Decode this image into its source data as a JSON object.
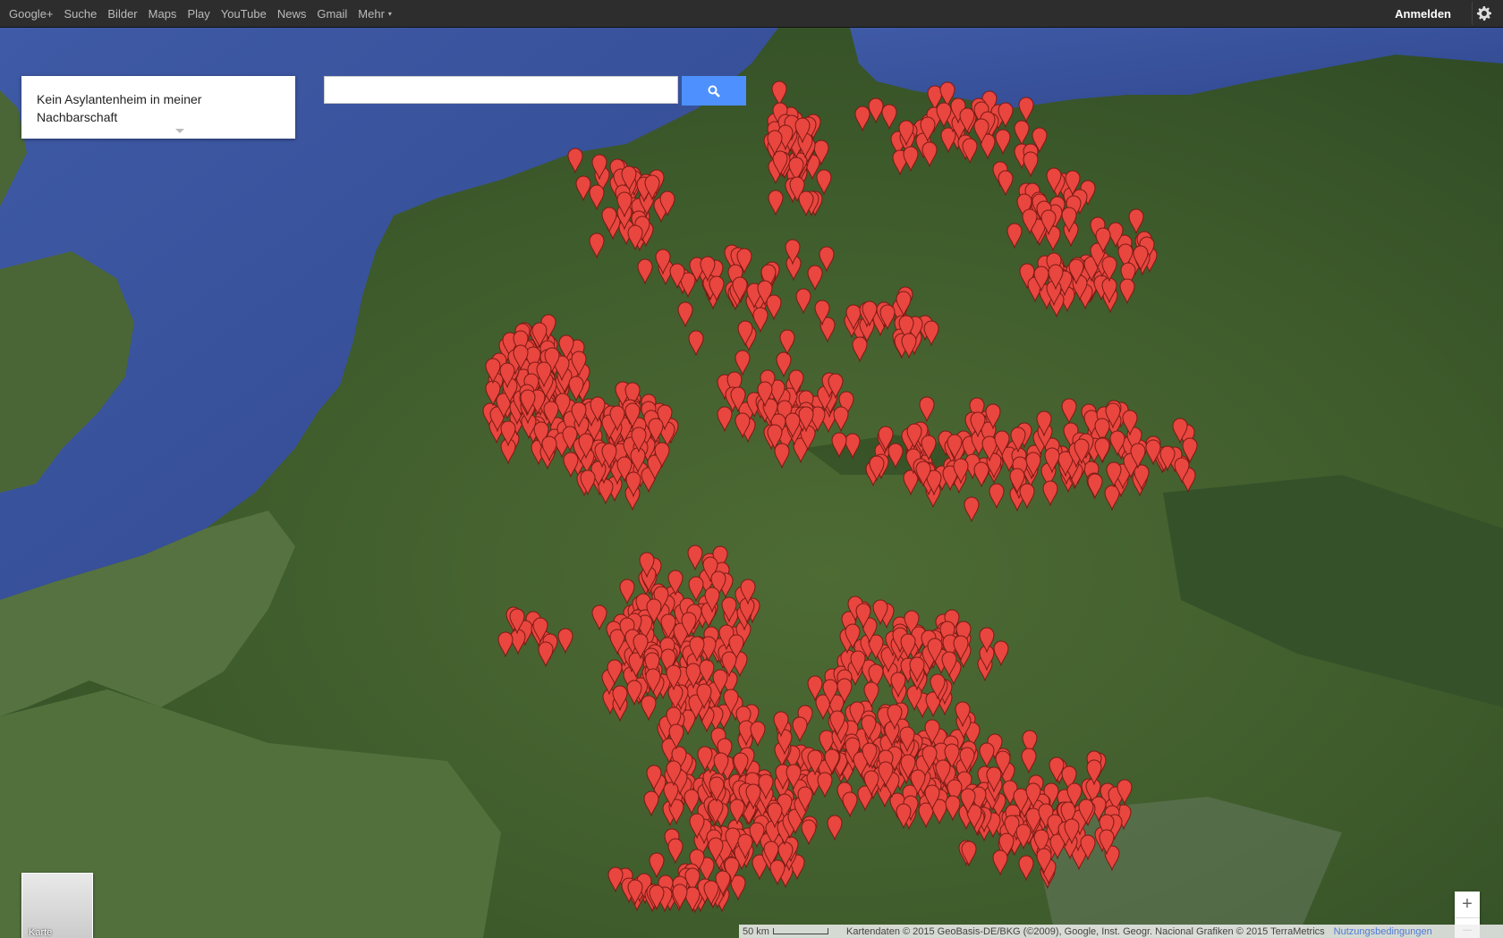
{
  "topbar": {
    "items": [
      "Google+",
      "Suche",
      "Bilder",
      "Maps",
      "Play",
      "YouTube",
      "News",
      "Gmail",
      "Mehr"
    ],
    "more_caret": "▾",
    "signin": "Anmelden",
    "settings_icon": "gear-icon"
  },
  "map_title": "Kein Asylantenheim in meiner Nachbarschaft",
  "search": {
    "placeholder": "",
    "value": "",
    "button_icon": "search-icon"
  },
  "map_type_label": "Karte",
  "zoom": {
    "in": "+",
    "out": "−"
  },
  "footer": {
    "scale_label": "50 km",
    "attribution": "Kartendaten © 2015 GeoBasis-DE/BKG (©2009), Google, Inst. Geogr. Nacional Grafiken © 2015 TerraMetrics",
    "terms": "Nutzungsbedingungen"
  },
  "colors": {
    "pin": "#e8463f",
    "pin_stroke": "#7a1a14",
    "search_button": "#4d90fe",
    "topbar": "#2d2d2d"
  }
}
